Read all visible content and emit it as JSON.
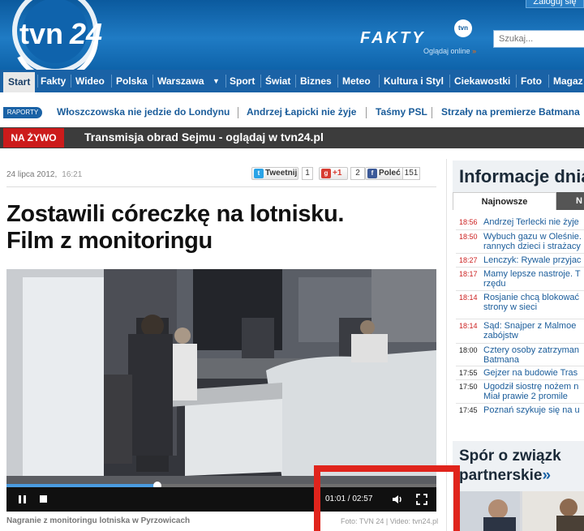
{
  "header": {
    "logo_text": "tvn24",
    "login_label": "Zaloguj się",
    "fakty_logo": "FAKTY",
    "fakty_badge": "tvn",
    "fakty_sub": "Oglądaj online",
    "fakty_sub_arrow": "»",
    "search_placeholder": "Szukaj..."
  },
  "nav": {
    "items": [
      "Start",
      "Fakty",
      "Wideo",
      "Polska",
      "Warszawa",
      "Sport",
      "Świat",
      "Biznes",
      "Meteo",
      "Kultura i Styl",
      "Ciekawostki",
      "Foto",
      "Magaz"
    ],
    "dropdown_arrow": "▼"
  },
  "reports": {
    "tag": "RAPORTY",
    "links": [
      "Włoszczowska nie jedzie do Londynu",
      "Andrzej Łapicki nie żyje",
      "Taśmy PSL",
      "Strzały na premierze Batmana"
    ]
  },
  "live": {
    "tag": "NA ŻYWO",
    "text": "Transmisja obrad Sejmu - oglądaj w tvn24.pl"
  },
  "article": {
    "date": "24 lipca 2012,",
    "time": "16:21",
    "title_line1": "Zostawili córeczkę na lotnisku.",
    "title_line2": "Film z monitoringu",
    "share": {
      "tweet_label": "Tweetnij",
      "tweet_count": "1",
      "gplus_label": "+1",
      "gplus_count": "2",
      "fb_label": "Poleć",
      "fb_count": "151"
    },
    "video": {
      "time": "01:01 / 02:57",
      "progress": 0.35
    },
    "caption": "Nagranie z monitoringu lotniska w Pyrzowicach",
    "credit": "Foto: TVN 24 | Video: tvn24.pl"
  },
  "sidebar": {
    "title": "Informacje dnia",
    "tab_active": "Najnowsze",
    "tab_other": "N",
    "news": [
      {
        "time": "18:56",
        "headline": "Andrzej Terlecki nie żyje",
        "red": true
      },
      {
        "time": "18:50",
        "headline": "Wybuch gazu w Oleśnie. rannych dzieci i strażacy",
        "red": true
      },
      {
        "time": "18:27",
        "headline": "Lenczyk: Rywale przyjac",
        "red": true
      },
      {
        "time": "18:17",
        "headline": "Mamy lepsze nastroje. T rzędu",
        "red": true
      },
      {
        "time": "18:14",
        "headline": "Rosjanie chcą blokować strony w sieci",
        "red": true
      },
      {
        "time": "18:14",
        "headline": "Sąd: Snajper z Malmoe zabójstw",
        "red": true
      },
      {
        "time": "18:00",
        "headline": "Cztery osoby zatrzyman Batmana",
        "red": false
      },
      {
        "time": "17:55",
        "headline": "Gejzer na budowie Tras",
        "red": false
      },
      {
        "time": "17:50",
        "headline": "Ugodził siostrę nożem n Miał prawie 2 promile",
        "red": false
      },
      {
        "time": "17:45",
        "headline": "Poznań szykuje się na u",
        "red": false
      }
    ],
    "promo_line1": "Spór o związk",
    "promo_line2": "partnerskie",
    "promo_arrow": "»"
  },
  "colors": {
    "header_blue": "#1f7bc4",
    "nav_blue": "#1a62a6",
    "live_red": "#cc1b1b",
    "highlight_red": "#e0241c",
    "link_blue": "#1a5c9a"
  }
}
